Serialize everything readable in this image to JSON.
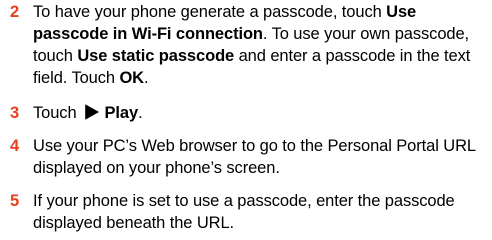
{
  "steps": [
    {
      "number": "2",
      "parts": [
        {
          "text": "To have your phone generate a passcode, touch ",
          "bold": false
        },
        {
          "text": "Use passcode in Wi-Fi connection",
          "bold": true
        },
        {
          "text": ". To use your own passcode, touch ",
          "bold": false
        },
        {
          "text": "Use static passcode",
          "bold": true
        },
        {
          "text": " and enter a passcode in the text field. Touch ",
          "bold": false
        },
        {
          "text": "OK",
          "bold": true
        },
        {
          "text": ".",
          "bold": false
        }
      ]
    },
    {
      "number": "3",
      "touch": "Touch",
      "icon": "play-icon",
      "label": "Play",
      "end": "."
    },
    {
      "number": "4",
      "text": "Use your PC’s Web browser to go to the Personal Portal URL displayed on your phone’s screen."
    },
    {
      "number": "5",
      "text": "If your phone is set to use a passcode, enter the passcode displayed beneath the URL."
    }
  ],
  "colors": {
    "step_number": "#e8401c",
    "text": "#000000"
  }
}
